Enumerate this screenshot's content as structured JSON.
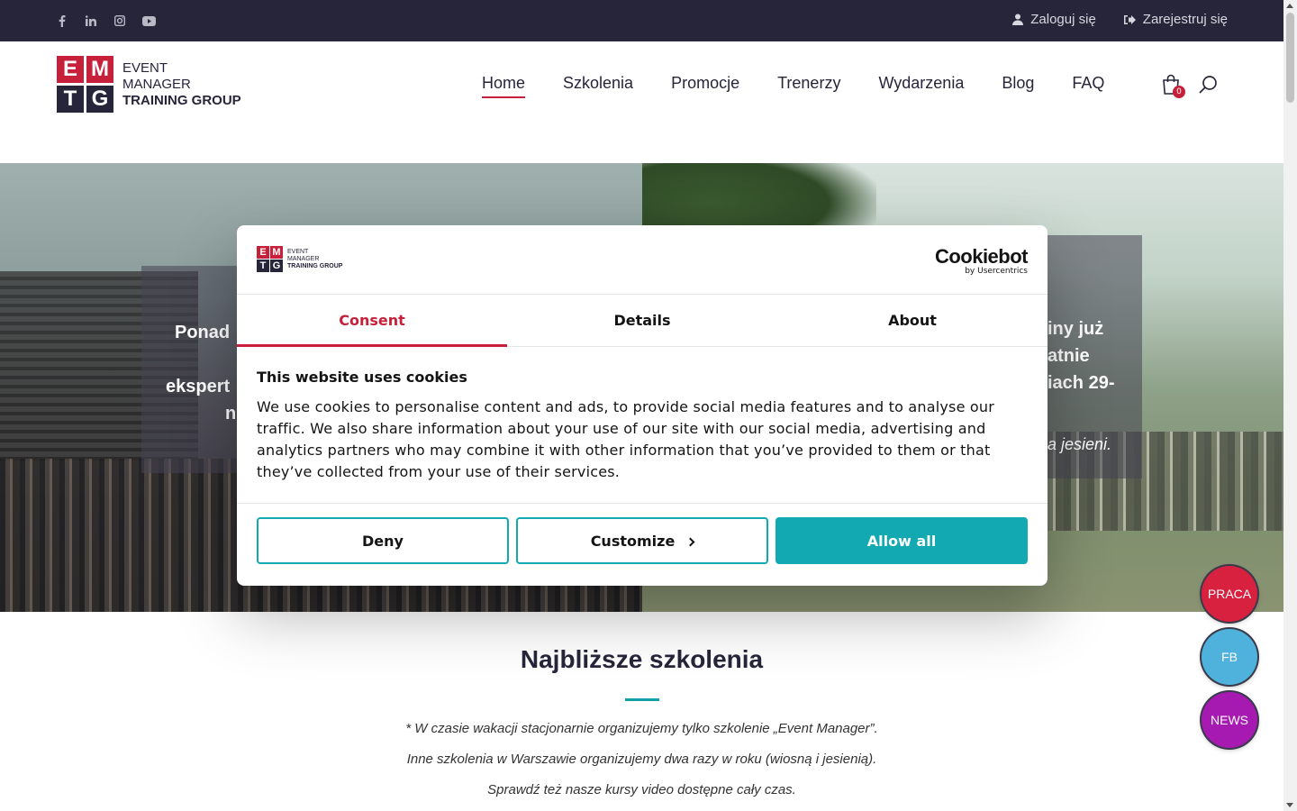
{
  "topbar": {
    "social_icons": [
      "facebook-icon",
      "linkedin-icon",
      "instagram-icon",
      "youtube-icon"
    ],
    "login_label": "Zaloguj się",
    "register_label": "Zarejestruj się"
  },
  "brand": {
    "letters": [
      "E",
      "M",
      "T",
      "G"
    ],
    "line1": "EVENT",
    "line2": "MANAGER",
    "line3": "TRAINING GROUP",
    "colors": {
      "red": "#c7203a",
      "dark": "#27253a",
      "teal": "#12a9b2"
    }
  },
  "nav": {
    "items": [
      "Home",
      "Szkolenia",
      "Promocje",
      "Trenerzy",
      "Wydarzenia",
      "Blog",
      "FAQ"
    ],
    "active": "Home",
    "cart_count": "0"
  },
  "hero": {
    "left_fragments": [
      "Ponad",
      "ekspert",
      "n"
    ],
    "right_fragments": [
      "iny już",
      "atnie",
      "iach 29-"
    ],
    "right_italic": "a jesieni."
  },
  "section": {
    "title": "Najbliższe szkolenia",
    "notes": [
      "* W czasie wakacji stacjonarnie organizujemy tylko szkolenie „Event Manager”.",
      "Inne szkolenia w Warszawie organizujemy dwa razy w roku (wiosną i jesienią).",
      "Sprawdź też nasze kursy video dostępne cały czas."
    ]
  },
  "floating": {
    "praca": "PRACA",
    "fb": "FB",
    "news": "NEWS"
  },
  "cookie_dialog": {
    "provider_main": "Cookiebot",
    "provider_sub": "by Usercentrics",
    "tabs": [
      "Consent",
      "Details",
      "About"
    ],
    "active_tab": "Consent",
    "heading": "This website uses cookies",
    "body": "We use cookies to personalise content and ads, to provide social media features and to analyse our traffic. We also share information about your use of our site with our social media, advertising and analytics partners who may combine it with other information that you’ve provided to them or that they’ve collected from your use of their services.",
    "deny_label": "Deny",
    "customize_label": "Customize",
    "allow_label": "Allow all"
  }
}
